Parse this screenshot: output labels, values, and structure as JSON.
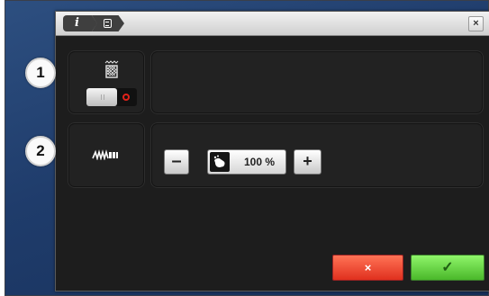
{
  "titlebar": {
    "crumbs": [
      {
        "label": "i",
        "icon": "info-icon"
      },
      {
        "icon": "machine-icon"
      }
    ],
    "close_label": "×"
  },
  "callouts": [
    "1",
    "2"
  ],
  "row1": {
    "icon": "embroidery-grid-icon",
    "toggle": {
      "state": "off",
      "off_indicator": "red-circle-icon",
      "off_color": "#e0221a"
    }
  },
  "row2": {
    "icon": "stitch-icon",
    "stepper": {
      "minus_label": "–",
      "plus_label": "+",
      "icon": "speed-hand-icon",
      "value": "100 %"
    }
  },
  "footer": {
    "cancel_label": "×",
    "confirm_label": "✓",
    "cancel_color": "#e0301e",
    "confirm_color": "#4ab82a"
  }
}
